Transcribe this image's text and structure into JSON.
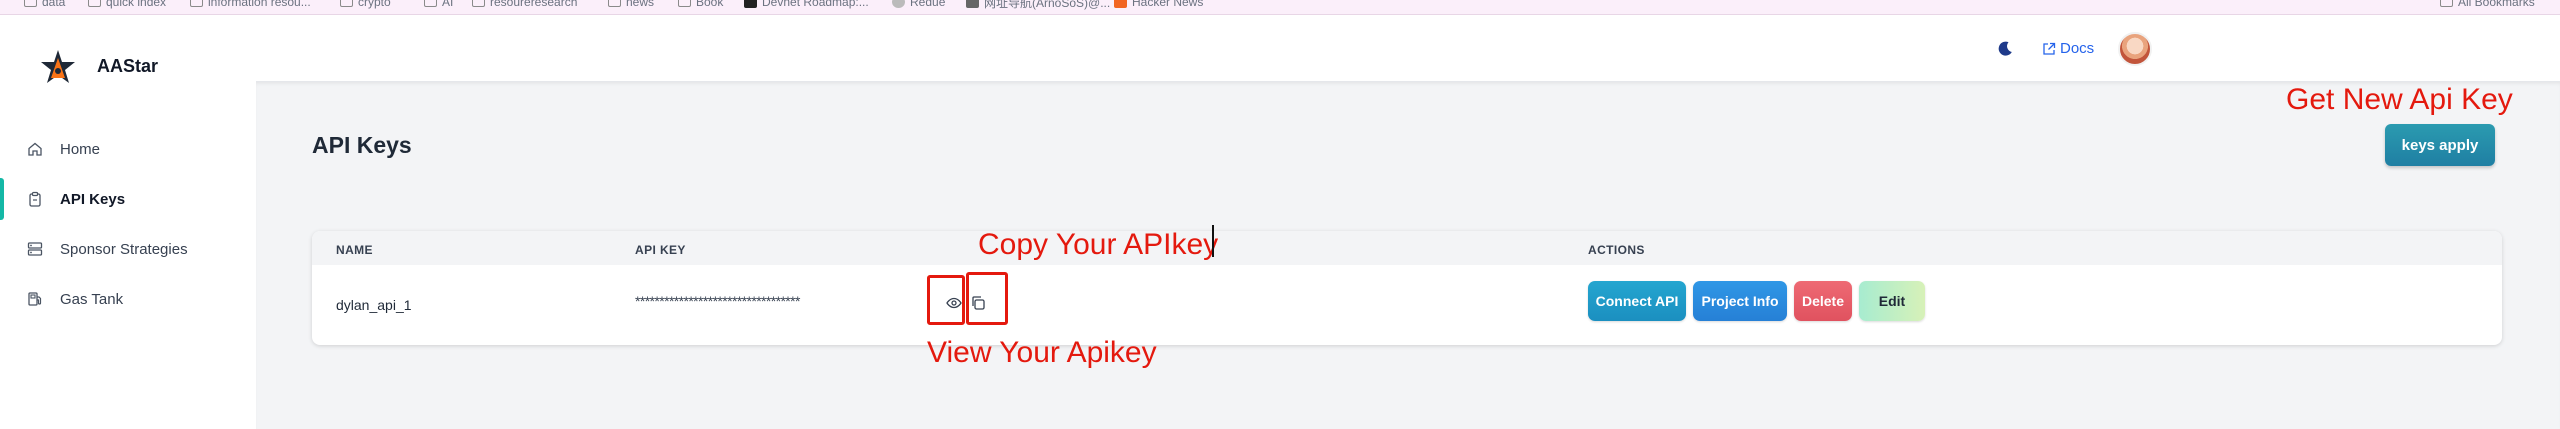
{
  "bookmarks": [
    {
      "label": "data",
      "kind": "folder"
    },
    {
      "label": "quick index",
      "kind": "folder"
    },
    {
      "label": "information resou...",
      "kind": "folder"
    },
    {
      "label": "crypto",
      "kind": "folder"
    },
    {
      "label": "AI",
      "kind": "folder"
    },
    {
      "label": "resoureresearch",
      "kind": "folder"
    },
    {
      "label": "news",
      "kind": "folder"
    },
    {
      "label": "Book",
      "kind": "folder"
    },
    {
      "label": "Devnet Roadmap:...",
      "kind": "site"
    },
    {
      "label": "Redue",
      "kind": "site"
    },
    {
      "label": "网址导航(ArnoSoS)@...",
      "kind": "site"
    },
    {
      "label": "Hacker News",
      "kind": "site"
    },
    {
      "label": "All Bookmarks",
      "kind": "folder"
    }
  ],
  "brand": {
    "name": "AAStar"
  },
  "sidebar": {
    "items": [
      {
        "label": "Home",
        "icon": "home-icon",
        "active": false
      },
      {
        "label": "API Keys",
        "icon": "clipboard-icon",
        "active": true
      },
      {
        "label": "Sponsor Strategies",
        "icon": "strategy-icon",
        "active": false
      },
      {
        "label": "Gas Tank",
        "icon": "gas-tank-icon",
        "active": false
      }
    ]
  },
  "header": {
    "docs_label": "Docs",
    "theme_icon": "moon-icon",
    "avatar": "user-avatar"
  },
  "page": {
    "title": "API Keys",
    "apply_button": "keys apply"
  },
  "table": {
    "headers": {
      "name": "NAME",
      "api_key": "API KEY",
      "actions": "ACTIONS"
    },
    "rows": [
      {
        "name": "dylan_api_1",
        "api_key_masked": "**********************************",
        "actions": {
          "connect": "Connect API",
          "project": "Project Info",
          "delete": "Delete",
          "edit": "Edit"
        }
      }
    ]
  },
  "annotations": {
    "get_new": "Get New Api Key",
    "copy": "Copy Your APIkey",
    "view": "View Your Apikey"
  },
  "colors": {
    "accent": "#14b8a6",
    "annotation": "#e4190e",
    "docs_link": "#2563eb",
    "connect_btn": "#1d9bc8",
    "project_btn": "#2b8be0",
    "delete_btn": "#e8596a",
    "edit_btn": "#b6ecc7"
  }
}
